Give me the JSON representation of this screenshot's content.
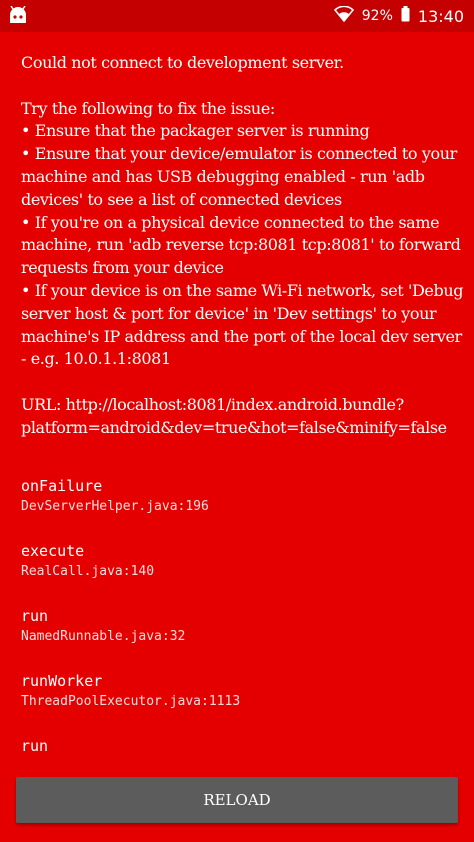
{
  "status_bar": {
    "app_icon": "android-robot-icon",
    "wifi_icon": "wifi-icon",
    "battery": "92%",
    "time": "13:40"
  },
  "redbox": {
    "message": "Could not connect to development server.\n\nTry the following to fix the issue:\n• Ensure that the packager server is running\n• Ensure that your device/emulator is connected to your machine and has USB debugging enabled - run 'adb devices' to see a list of connected devices\n• If you're on a physical device connected to the same machine, run 'adb reverse tcp:8081 tcp:8081' to forward requests from your device\n• If your device is on the same Wi-Fi network, set 'Debug server host & port for device' in 'Dev settings' to your machine's IP address and the port of the local dev server - e.g. 10.0.1.1:8081\n\nURL: http://localhost:8081/index.android.bundle?platform=android&dev=true&hot=false&minify=false",
    "stack": [
      {
        "method": "onFailure",
        "file": "DevServerHelper.java:196"
      },
      {
        "method": "execute",
        "file": "RealCall.java:140"
      },
      {
        "method": "run",
        "file": "NamedRunnable.java:32"
      },
      {
        "method": "runWorker",
        "file": "ThreadPoolExecutor.java:1113"
      },
      {
        "method": "run",
        "file": ""
      }
    ],
    "reload_label": "RELOAD"
  },
  "colors": {
    "background": "#e50000",
    "status_bar": "#c40000",
    "button": "#5c5c5c"
  }
}
